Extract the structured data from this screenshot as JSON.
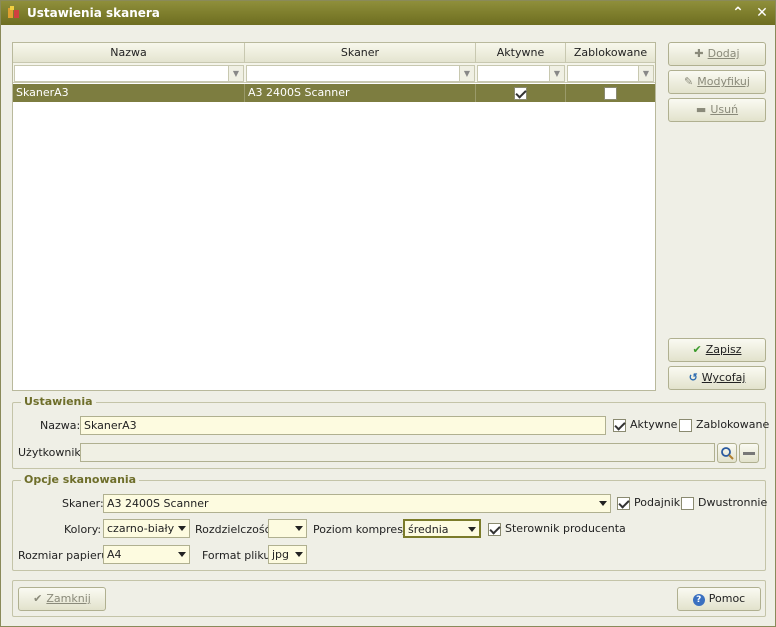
{
  "window": {
    "title": "Ustawienia skanera"
  },
  "grid": {
    "columns": [
      "Nazwa",
      "Skaner",
      "Aktywne",
      "Zablokowane"
    ],
    "rows": [
      {
        "name": "SkanerA3",
        "scanner": "A3 2400S Scanner",
        "active": true,
        "blocked": false
      }
    ]
  },
  "side_buttons": {
    "add": "Dodaj",
    "modify": "Modyfikuj",
    "delete": "Usuń",
    "save": "Zapisz",
    "revert": "Wycofaj"
  },
  "settings": {
    "title": "Ustawienia",
    "name_label": "Nazwa:",
    "name_value": "SkanerA3",
    "active_label": "Aktywne",
    "active_checked": true,
    "blocked_label": "Zablokowane",
    "blocked_checked": false,
    "user_label": "Użytkownik:",
    "user_value": ""
  },
  "scan_options": {
    "title": "Opcje skanowania",
    "scanner_label": "Skaner:",
    "scanner_value": "A3 2400S Scanner",
    "feeder_label": "Podajnik",
    "feeder_checked": true,
    "duplex_label": "Dwustronnie",
    "duplex_checked": false,
    "colors_label": "Kolory:",
    "colors_value": "czarno-biały",
    "resolution_label": "Rozdzielczość:",
    "resolution_value": "",
    "compression_label": "Poziom kompresji:",
    "compression_value": "średnia",
    "vendor_driver_label": "Sterownik producenta",
    "vendor_driver_checked": true,
    "paper_label": "Rozmiar papieru:",
    "paper_value": "A4",
    "format_label": "Format pliku:",
    "format_value": "jpg"
  },
  "footer": {
    "close": "Zamknij",
    "help": "Pomoc"
  },
  "colors": {
    "title_bar": "#7b7b2a",
    "selected_row": "#7d7d40",
    "group_title": "#6e6e2a",
    "input_bg": "#fdfbe0"
  }
}
